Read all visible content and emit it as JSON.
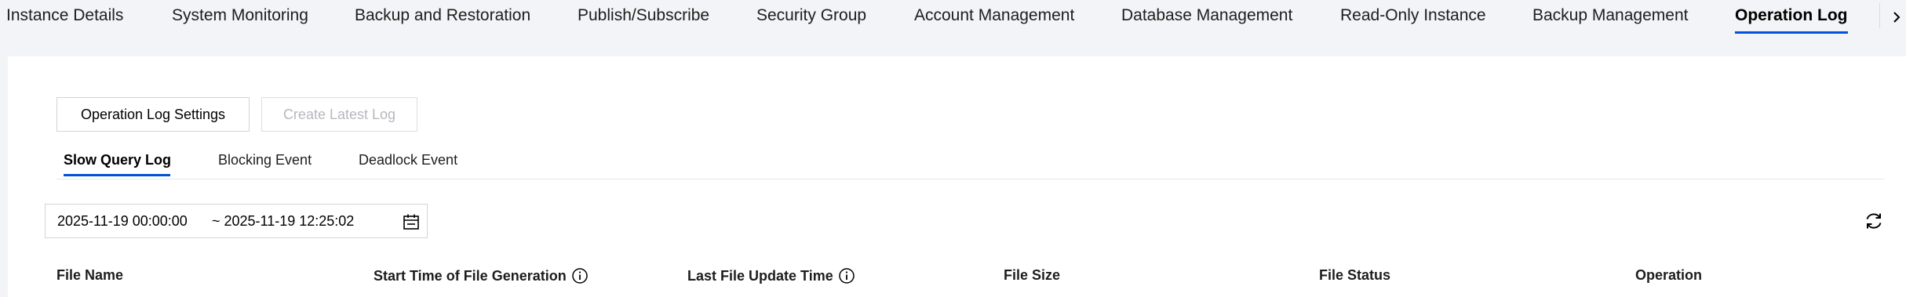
{
  "top_tabs": [
    {
      "label": "Instance Details"
    },
    {
      "label": "System Monitoring"
    },
    {
      "label": "Backup and Restoration"
    },
    {
      "label": "Publish/Subscribe"
    },
    {
      "label": "Security Group"
    },
    {
      "label": "Account Management"
    },
    {
      "label": "Database Management"
    },
    {
      "label": "Read-Only Instance"
    },
    {
      "label": "Backup Management"
    },
    {
      "label": "Operation Log"
    }
  ],
  "active_top_tab": "Operation Log",
  "toolbar": {
    "settings_label": "Operation Log Settings",
    "create_label": "Create Latest Log"
  },
  "sub_tabs": [
    {
      "label": "Slow Query Log"
    },
    {
      "label": "Blocking Event"
    },
    {
      "label": "Deadlock Event"
    }
  ],
  "active_sub_tab": "Slow Query Log",
  "date_range": {
    "start": "2025-11-19 00:00:00",
    "end": "~ 2025-11-19 12:25:02"
  },
  "table": {
    "columns": [
      {
        "label": "File Name",
        "info": false
      },
      {
        "label": "Start Time of File Generation",
        "info": true
      },
      {
        "label": "Last File Update Time",
        "info": true
      },
      {
        "label": "File Size",
        "info": false
      },
      {
        "label": "File Status",
        "info": false
      },
      {
        "label": "Operation",
        "info": false
      }
    ]
  },
  "icons": {
    "more": "chevron-right-icon",
    "calendar": "calendar-icon",
    "refresh": "refresh-icon",
    "info": "info-icon"
  },
  "colors": {
    "accent": "#0052d9",
    "page_background": "#f3f4f7",
    "panel_background": "#ffffff",
    "disabled_text": "#b6b8bd"
  }
}
